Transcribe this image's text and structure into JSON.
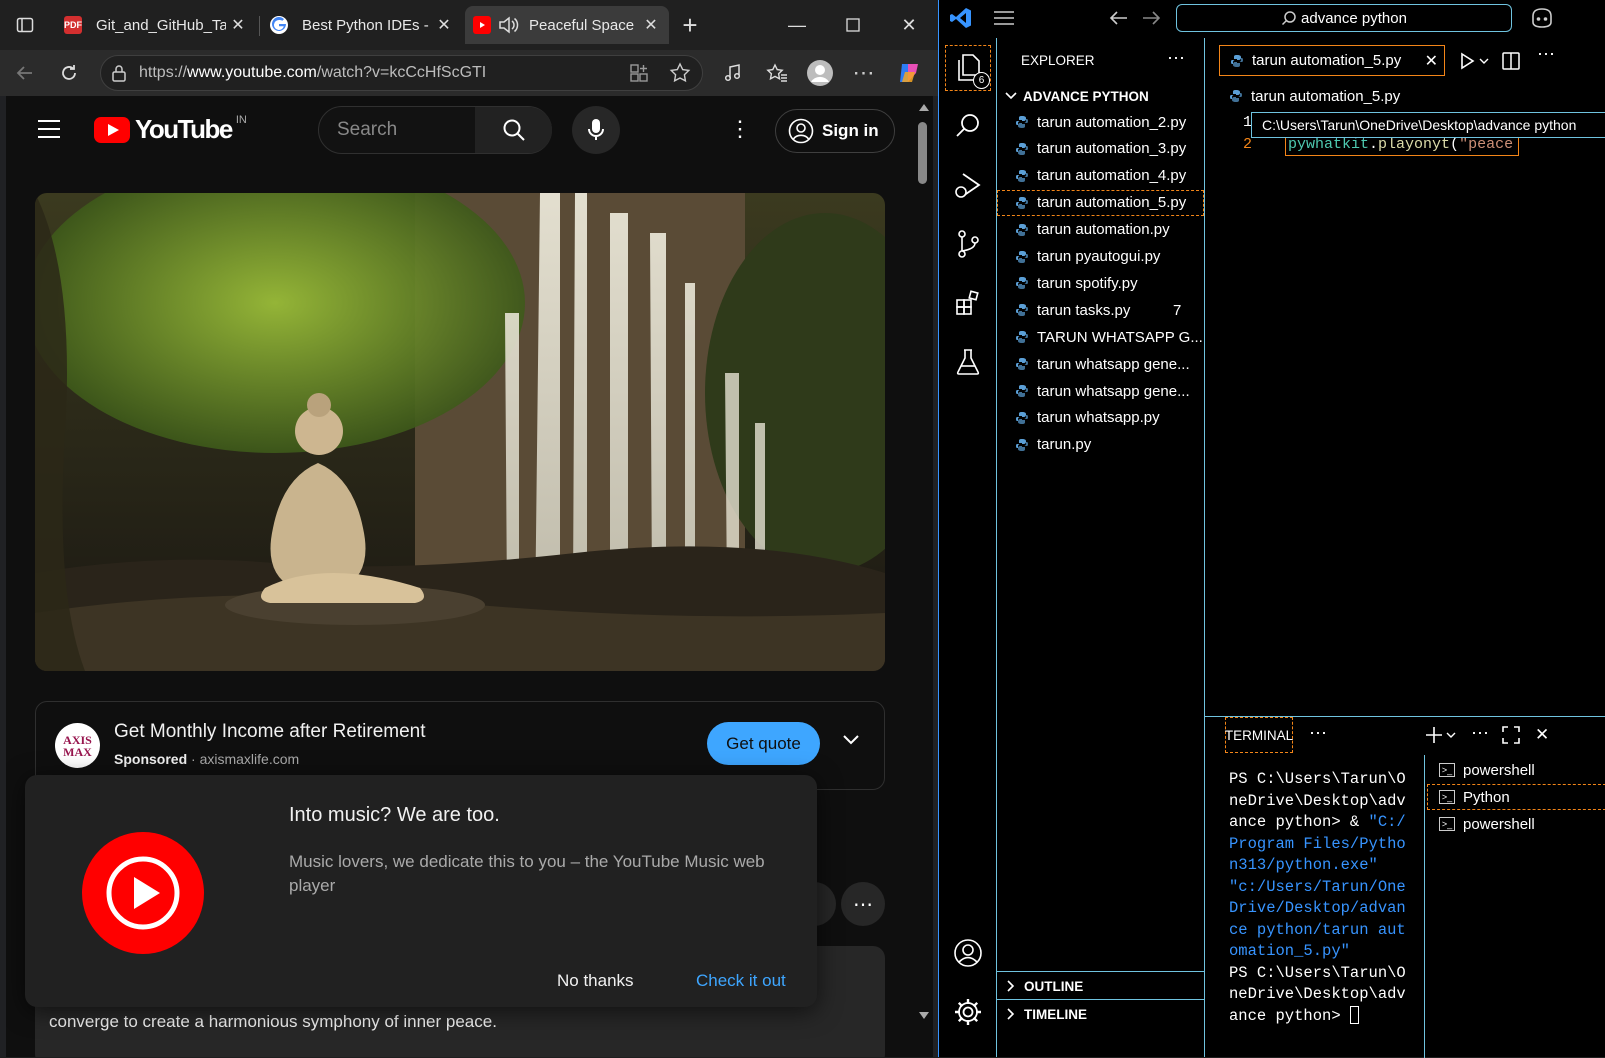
{
  "browser": {
    "tabs": [
      {
        "title": "Git_and_GitHub_Tasks",
        "icon": "pdf-icon"
      },
      {
        "title": "Best Python IDEs - Google Search",
        "icon": "google-icon"
      },
      {
        "title": "Peaceful Space",
        "icon": "youtube-icon",
        "active": true
      }
    ],
    "address": {
      "prefix": "https://",
      "host": "www.youtube.com",
      "path": "/watch?v=kcCcHfScGTI"
    },
    "colors": {
      "youtube_red": "#ff0000",
      "blue_button": "#3ea6ff"
    }
  },
  "youtube": {
    "logo_text": "YouTube",
    "region": "IN",
    "search_placeholder": "Search",
    "sign_in": "Sign in",
    "ad": {
      "advertiser_logo": "AXIS MAX",
      "title": "Get Monthly Income after Retirement",
      "sponsored": "Sponsored",
      "domain": "axismaxlife.com",
      "cta": "Get quote"
    },
    "popup": {
      "title": "Into music? We are too.",
      "body": "Music lovers, we dedicate this to you – the YouTube Music web player",
      "dismiss": "No thanks",
      "accept": "Check it out"
    },
    "description_snippet": "converge to create a harmonious symphony of inner peace."
  },
  "vscode": {
    "search_box": "advance python",
    "explorer_title": "EXPLORER",
    "folder": "ADVANCE PYTHON",
    "activity_badge": "6",
    "files": [
      {
        "name": "tarun automation_2.py"
      },
      {
        "name": "tarun automation_3.py"
      },
      {
        "name": "tarun automation_4.py"
      },
      {
        "name": "tarun automation_5.py",
        "selected": true
      },
      {
        "name": "tarun automation.py"
      },
      {
        "name": "tarun pyautogui.py"
      },
      {
        "name": "tarun spotify.py"
      },
      {
        "name": "tarun tasks.py",
        "badge": "7"
      },
      {
        "name": "TARUN WHATSAPP G..."
      },
      {
        "name": "tarun whatsapp gene..."
      },
      {
        "name": "tarun whatsapp gene..."
      },
      {
        "name": "tarun whatsapp.py"
      },
      {
        "name": "tarun.py"
      }
    ],
    "outline": "OUTLINE",
    "timeline": "TIMELINE",
    "editor_tab": "tarun automation_5.py",
    "breadcrumb": "tarun automation_5.py",
    "hover_path": "C:\\Users\\Tarun\\OneDrive\\Desktop\\advance python",
    "code": {
      "line_numbers": [
        "1",
        "2"
      ],
      "line2_obj": "pywhatkit",
      "line2_dot": ".",
      "line2_fn": "playonyt",
      "line2_paren": "(",
      "line2_str": "\"peace"
    },
    "panel_tab": "TERMINAL",
    "terminal": {
      "prompt1": "PS C:\\Users\\Tarun\\OneDrive\\Desktop\\advance python> & ",
      "cmd_str1": "\"C:/Program Files/Python313/python.exe\"",
      "cmd_space": " ",
      "cmd_str2": "\"c:/Users/Tarun/OneDrive/Desktop/advance python/tarun automation_5.py\"",
      "prompt2": "PS C:\\Users\\Tarun\\OneDrive\\Desktop\\advance python> "
    },
    "terminal_list": [
      "powershell",
      "Python",
      "powershell"
    ]
  }
}
